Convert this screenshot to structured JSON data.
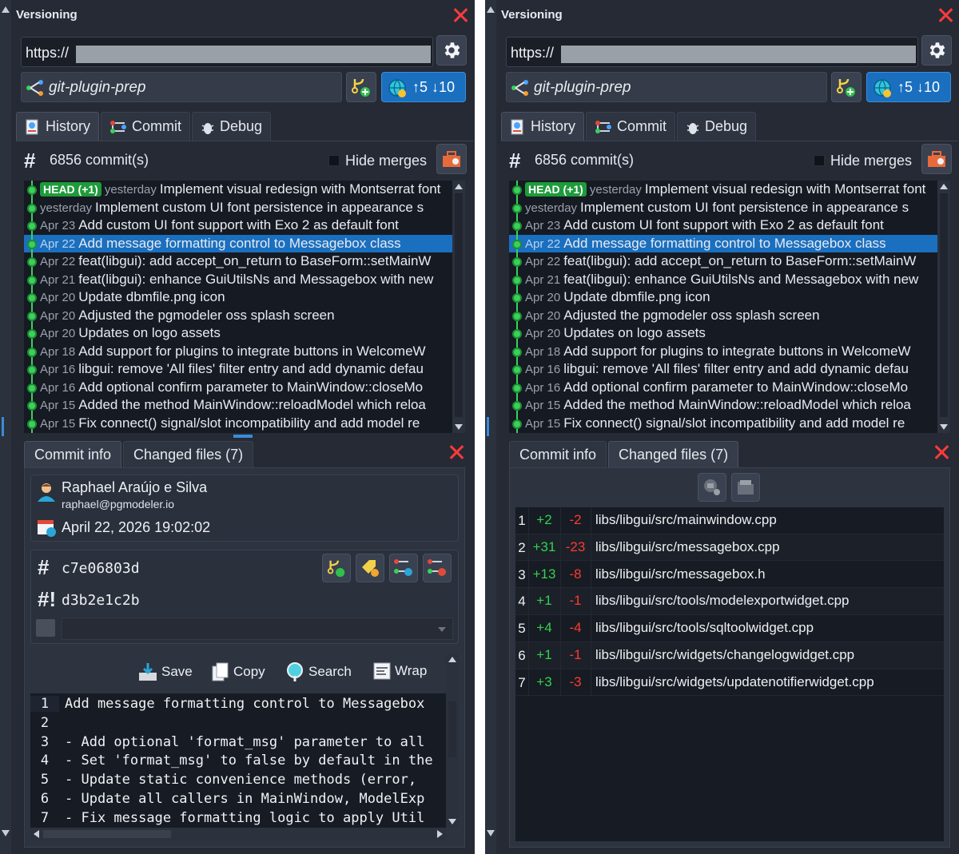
{
  "panel": {
    "title": "Versioning",
    "url_prefix": "https://",
    "branch": "git-plugin-prep",
    "sync": {
      "ahead": "↑5",
      "behind": "↓10"
    },
    "tabs": [
      "History",
      "Commit",
      "Debug"
    ],
    "commit_count": "6856 commit(s)",
    "hide_merges_label": "Hide merges",
    "commits": [
      {
        "badge": "HEAD (+1)",
        "date": "yesterday",
        "msg": "Implement visual redesign with Montserrat font"
      },
      {
        "badge": "",
        "date": "yesterday",
        "msg": "Implement custom UI font persistence in appearance s"
      },
      {
        "badge": "",
        "date": "Apr 23",
        "msg": "Add custom UI font support with Exo 2 as default font"
      },
      {
        "badge": "",
        "date": "Apr 22",
        "msg": "Add message formatting control to Messagebox class"
      },
      {
        "badge": "",
        "date": "Apr 22",
        "msg": "feat(libgui): add accept_on_return to BaseForm::setMainW"
      },
      {
        "badge": "",
        "date": "Apr 21",
        "msg": "feat(libgui): enhance GuiUtilsNs and Messagebox with new"
      },
      {
        "badge": "",
        "date": "Apr 20",
        "msg": "Update dbmfile.png icon"
      },
      {
        "badge": "",
        "date": "Apr 20",
        "msg": "Adjusted the pgmodeler oss splash screen"
      },
      {
        "badge": "",
        "date": "Apr 20",
        "msg": "Updates on logo assets"
      },
      {
        "badge": "",
        "date": "Apr 18",
        "msg": "Add support for plugins to integrate buttons in WelcomeW"
      },
      {
        "badge": "",
        "date": "Apr 16",
        "msg": "libgui: remove 'All files' filter entry and add dynamic defau"
      },
      {
        "badge": "",
        "date": "Apr 16",
        "msg": "Add optional confirm parameter to MainWindow::closeMo"
      },
      {
        "badge": "",
        "date": "Apr 15",
        "msg": "Added the method MainWindow::reloadModel which reloa"
      },
      {
        "badge": "",
        "date": "Apr 15",
        "msg": "Fix connect() signal/slot incompatibility and add model re"
      }
    ],
    "selected_index": 3,
    "detail_tabs": [
      "Commit info",
      "Changed files (7)"
    ]
  },
  "commit_info": {
    "author": "Raphael Araújo e Silva",
    "email": "raphael@pgmodeler.io",
    "date": "April 22, 2026 19:02:02",
    "hash": "c7e06803d",
    "parent_hash": "d3b2e1c2b",
    "toolbar": {
      "save": "Save",
      "copy": "Copy",
      "search": "Search",
      "wrap": "Wrap"
    },
    "message_lines": [
      {
        "n": "1",
        "text": "Add message formatting control to Messagebox"
      },
      {
        "n": "2",
        "text": ""
      },
      {
        "n": "3",
        "text": "- Add optional 'format_msg' parameter to all"
      },
      {
        "n": "4",
        "text": "- Set 'format_msg' to false by default in the"
      },
      {
        "n": "5",
        "text": "- Update static convenience methods (error,"
      },
      {
        "n": "6",
        "text": "- Update all callers in MainWindow, ModelExp"
      },
      {
        "n": "7",
        "text": "- Fix message formatting logic to apply Util"
      }
    ]
  },
  "changed_files": [
    {
      "n": "1",
      "add": "+2",
      "del": "-2",
      "path": "libs/libgui/src/mainwindow.cpp"
    },
    {
      "n": "2",
      "add": "+31",
      "del": "-23",
      "path": "libs/libgui/src/messagebox.cpp"
    },
    {
      "n": "3",
      "add": "+13",
      "del": "-8",
      "path": "libs/libgui/src/messagebox.h"
    },
    {
      "n": "4",
      "add": "+1",
      "del": "-1",
      "path": "libs/libgui/src/tools/modelexportwidget.cpp"
    },
    {
      "n": "5",
      "add": "+4",
      "del": "-4",
      "path": "libs/libgui/src/tools/sqltoolwidget.cpp"
    },
    {
      "n": "6",
      "add": "+1",
      "del": "-1",
      "path": "libs/libgui/src/widgets/changelogwidget.cpp"
    },
    {
      "n": "7",
      "add": "+3",
      "del": "-3",
      "path": "libs/libgui/src/widgets/updatenotifierwidget.cpp"
    }
  ],
  "colors": {
    "accent": "#1a6fbf",
    "graph": "#3ad15a",
    "added": "#32d24e",
    "removed": "#ff3b30",
    "close": "#ff3a3a"
  }
}
